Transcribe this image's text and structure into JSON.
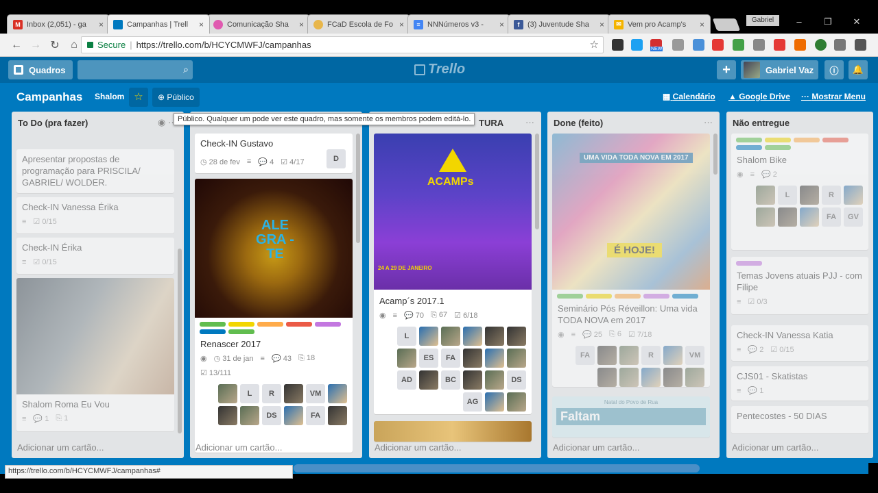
{
  "browser": {
    "tabs": [
      {
        "label": "Inbox (2,051) - ga",
        "icon": "gmail-icon",
        "color": "#d93025"
      },
      {
        "label": "Campanhas | Trell",
        "icon": "trello-icon",
        "color": "#0079bf"
      },
      {
        "label": "Comunicação Sha",
        "icon": "circle-icon",
        "color": "#e05ab0"
      },
      {
        "label": "FCaD Escola de Fo",
        "icon": "smile-icon",
        "color": "#e8b64a"
      },
      {
        "label": "NNNúmeros v3 -",
        "icon": "doc-icon",
        "color": "#4285f4"
      },
      {
        "label": "(3) Juventude Sha",
        "icon": "facebook-icon",
        "color": "#3b5998"
      },
      {
        "label": "Vem pro Acamp's",
        "icon": "mail-icon",
        "color": "#f4b400"
      }
    ],
    "tab_close": "×",
    "window_user": "Gabriel",
    "window_buttons": [
      "–",
      "❐",
      "✕"
    ],
    "secure_label": "Secure",
    "url": "https://trello.com/b/HCYCMWFJ/campanhas",
    "status_url": "https://trello.com/b/HCYCMWFJ/campanhas#",
    "ext_badge": "NEW"
  },
  "header": {
    "boards_label": "Quadros",
    "logo": "Trello",
    "user_name": "Gabriel Vaz"
  },
  "board": {
    "title": "Campanhas",
    "team": "Shalom",
    "visibility": "Público",
    "tooltip": "Público. Qualquer um pode ver este quadro, mas somente os membros podem editá-lo.",
    "calendar": "Calendário",
    "drive": "Google Drive",
    "menu": "Mostrar Menu"
  },
  "lists": [
    {
      "title": "To Do (pra fazer)",
      "add": "Adicionar um cartão...",
      "cards": [
        {
          "title": "Apresentar propostas de programação para PRISCILA/ GABRIEL/ WOLDER."
        },
        {
          "title": "Check-IN Vanessa Érika",
          "check": "0/15"
        },
        {
          "title": "Check-IN Érika",
          "check": "0/15"
        },
        {
          "title": "Shalom Roma Eu Vou",
          "comments": "1",
          "attach": "1"
        }
      ]
    },
    {
      "title": "",
      "add": "Adicionar um cartão...",
      "cards": [
        {
          "title": "Check-IN Gustavo",
          "due": "28 de fev",
          "comments": "4",
          "check": "4/17",
          "member": "D"
        },
        {
          "title": "Renascer 2017",
          "due": "31 de jan",
          "comments": "43",
          "attach": "18",
          "check": "13/111",
          "image_text": "ALE GRA -TE",
          "members": [
            "",
            "L",
            "R",
            "",
            "VM",
            "",
            "",
            "",
            "DS",
            "",
            "FA",
            ""
          ]
        }
      ]
    },
    {
      "title": "TURA",
      "add": "Adicionar um cartão...",
      "cards": [
        {
          "title": "Acamp´s 2017.1",
          "views": "70",
          "attach": "67",
          "check": "6/18",
          "image_text": "ACAMPs",
          "image_sub": "24 A 29 DE JANEIRO",
          "members": [
            "L",
            "",
            "",
            "",
            "",
            "",
            "",
            "ES",
            "FA",
            "",
            "",
            "",
            "AD",
            "",
            "BC",
            "",
            "",
            "DS",
            "AG",
            "",
            ""
          ]
        }
      ]
    },
    {
      "title": "Done (feito)",
      "add": "Adicionar um cartão...",
      "cards": [
        {
          "title": "Seminário Pós Réveillon: Uma vida TODA NOVA em 2017",
          "comments": "25",
          "attach": "6",
          "check": "7/18",
          "image_text": "UMA VIDA TODA NOVA EM 2017",
          "image_sub": "É HOJE!",
          "members": [
            "FA",
            "",
            "",
            "R",
            "",
            "VM",
            "",
            "",
            "",
            "",
            ""
          ]
        },
        {
          "title": "Faltam",
          "image_sub": "Natal do Povo de Rua"
        }
      ]
    },
    {
      "title": "Não entregue",
      "add": "Adicionar um cartão...",
      "cards": [
        {
          "title": "Shalom Bike",
          "comments": "2",
          "members": [
            "",
            "L",
            "",
            "R",
            "",
            "",
            "",
            "",
            "FA",
            "GV"
          ]
        },
        {
          "title": "Temas Jovens atuais PJJ - com Filipe",
          "check": "0/3"
        },
        {
          "title": "Check-IN Vanessa Katia",
          "comments": "2",
          "check": "0/15"
        },
        {
          "title": "CJS01 - Skatistas",
          "comments": "1"
        },
        {
          "title": "Pentecostes - 50 DIAS"
        }
      ]
    }
  ],
  "colors": {
    "board_bg": "#0079bf",
    "header_bg": "#0067a3",
    "label_green": "#61bd4f",
    "label_yellow": "#f2d600",
    "label_orange": "#ffab4a",
    "label_red": "#eb5a46",
    "label_purple": "#c377e0",
    "label_blue": "#0079bf"
  }
}
